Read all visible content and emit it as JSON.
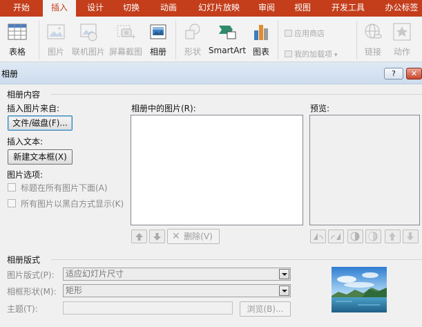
{
  "ribbon": {
    "tabs": [
      "开始",
      "插入",
      "设计",
      "切换",
      "动画",
      "幻灯片放映",
      "审阅",
      "视图",
      "开发工具",
      "办公标签"
    ],
    "active_tab": "插入",
    "buttons": {
      "table": "表格",
      "picture": "图片",
      "online_picture": "联机图片",
      "screenshot": "屏幕截图",
      "album": "相册",
      "shapes": "形状",
      "smartart": "SmartArt",
      "chart": "图表",
      "store": "应用商店",
      "my_addins": "我的加载项",
      "link": "链接",
      "action": "动作"
    }
  },
  "dialog": {
    "title": "相册",
    "help_label": "?",
    "close_label": "✕",
    "content_group": "相册内容",
    "insert_from_label": "插入图片来自:",
    "file_disk_button": "文件/磁盘(F)...",
    "insert_text_label": "插入文本:",
    "new_textbox_button": "新建文本框(X)",
    "picture_options_label": "图片选项:",
    "option_caption": "标题在所有图片下面(A)",
    "option_bw": "所有图片以黑白方式显示(K)",
    "pictures_in_album_label": "相册中的图片(R):",
    "preview_label": "预览:",
    "remove_button": "删除(V)",
    "layout_group": "相册版式",
    "picture_layout_label": "图片版式(P):",
    "picture_layout_value": "适应幻灯片尺寸",
    "frame_shape_label": "相框形状(M):",
    "frame_shape_value": "矩形",
    "theme_label": "主题(T):",
    "theme_value": "",
    "browse_button": "浏览(B)..."
  },
  "colors": {
    "ribbon_accent": "#c43e1c",
    "dialog_title_bg": "#dfe9f5",
    "dialog_bg": "#f0f0f0"
  }
}
